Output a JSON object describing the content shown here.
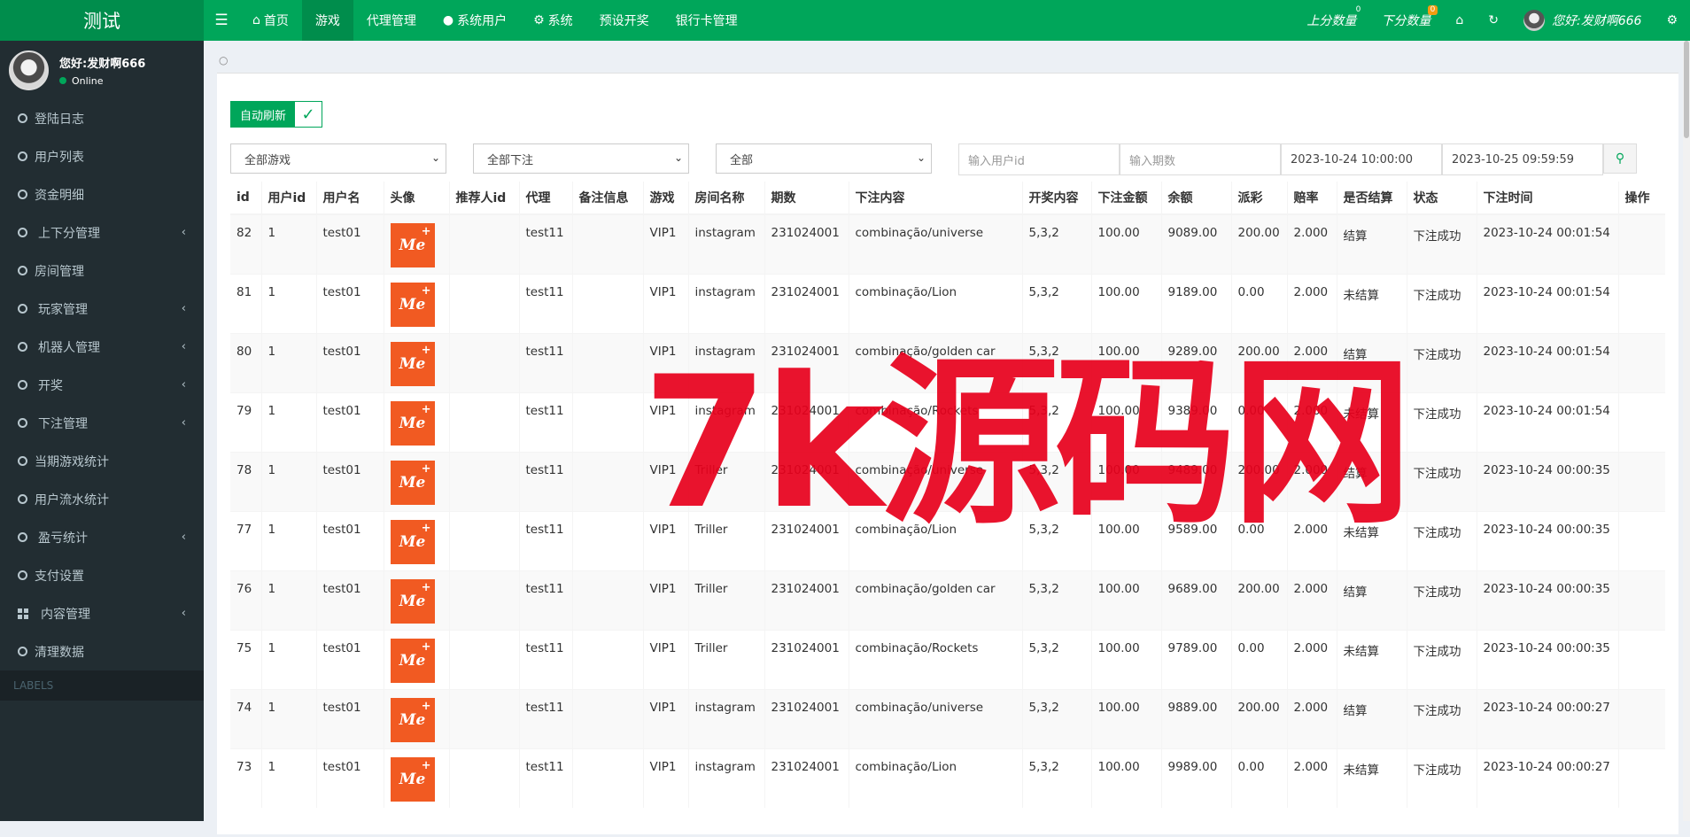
{
  "brand": "测试",
  "nav": {
    "items": [
      {
        "label": "首页",
        "icon": "home-icon"
      },
      {
        "label": "游戏",
        "active": true
      },
      {
        "label": "代理管理"
      },
      {
        "label": "系统用户",
        "icon": "user-icon"
      },
      {
        "label": "系统",
        "icon": "gear-icon"
      },
      {
        "label": "预设开奖"
      },
      {
        "label": "银行卡管理"
      }
    ],
    "up_score": "上分数量",
    "up_badge": "0",
    "down_score": "下分数量",
    "down_badge": "0",
    "greeting": "您好:发财啊666"
  },
  "sidebar": {
    "user_name": "您好:发财啊666",
    "status": "Online",
    "items": [
      {
        "label": "登陆日志"
      },
      {
        "label": "用户列表"
      },
      {
        "label": "资金明细"
      },
      {
        "label": "上下分管理",
        "has_children": true
      },
      {
        "label": "房间管理"
      },
      {
        "label": "玩家管理",
        "has_children": true
      },
      {
        "label": "机器人管理",
        "has_children": true
      },
      {
        "label": "开奖",
        "has_children": true
      },
      {
        "label": "下注管理",
        "has_children": true
      },
      {
        "label": "当期游戏统计"
      },
      {
        "label": "用户流水统计"
      },
      {
        "label": "盈亏统计",
        "has_children": true
      },
      {
        "label": "支付设置"
      },
      {
        "label": "内容管理",
        "has_children": true,
        "icon": "grid-icon"
      },
      {
        "label": "清理数据"
      }
    ],
    "labels_header": "LABELS"
  },
  "toolbar": {
    "auto_refresh": "自动刷新",
    "game_select": "全部游戏",
    "bet_select": "全部下注",
    "all_select": "全部",
    "user_id_placeholder": "输入用户id",
    "period_placeholder": "输入期数",
    "start_time": "2023-10-24 10:00:00",
    "end_time": "2023-10-25 09:59:59"
  },
  "table": {
    "headers": [
      "id",
      "用户id",
      "用户名",
      "头像",
      "推荐人id",
      "代理",
      "备注信息",
      "游戏",
      "房间名称",
      "期数",
      "下注内容",
      "开奖内容",
      "下注金额",
      "余额",
      "派彩",
      "赔率",
      "是否结算",
      "状态",
      "下注时间",
      "操作"
    ],
    "avatar_text": "Me",
    "rows": [
      {
        "id": "82",
        "uid": "1",
        "uname": "test01",
        "ref": "",
        "agent": "test11",
        "note": "",
        "game": "VIP1",
        "room": "instagram",
        "period": "231024001",
        "bet": "combinação/universe",
        "draw": "5,3,2",
        "amount": "100.00",
        "balance": "9089.00",
        "payout": "200.00",
        "odds": "2.000",
        "settled": "结算",
        "status": "下注成功",
        "time": "2023-10-24 00:01:54"
      },
      {
        "id": "81",
        "uid": "1",
        "uname": "test01",
        "ref": "",
        "agent": "test11",
        "note": "",
        "game": "VIP1",
        "room": "instagram",
        "period": "231024001",
        "bet": "combinação/Lion",
        "draw": "5,3,2",
        "amount": "100.00",
        "balance": "9189.00",
        "payout": "0.00",
        "odds": "2.000",
        "settled": "未结算",
        "status": "下注成功",
        "time": "2023-10-24 00:01:54"
      },
      {
        "id": "80",
        "uid": "1",
        "uname": "test01",
        "ref": "",
        "agent": "test11",
        "note": "",
        "game": "VIP1",
        "room": "instagram",
        "period": "231024001",
        "bet": "combinação/golden car",
        "draw": "5,3,2",
        "amount": "100.00",
        "balance": "9289.00",
        "payout": "200.00",
        "odds": "2.000",
        "settled": "结算",
        "status": "下注成功",
        "time": "2023-10-24 00:01:54"
      },
      {
        "id": "79",
        "uid": "1",
        "uname": "test01",
        "ref": "",
        "agent": "test11",
        "note": "",
        "game": "VIP1",
        "room": "instagram",
        "period": "231024001",
        "bet": "combinação/Rockets",
        "draw": "5,3,2",
        "amount": "100.00",
        "balance": "9389.00",
        "payout": "0.00",
        "odds": "2.000",
        "settled": "未结算",
        "status": "下注成功",
        "time": "2023-10-24 00:01:54"
      },
      {
        "id": "78",
        "uid": "1",
        "uname": "test01",
        "ref": "",
        "agent": "test11",
        "note": "",
        "game": "VIP1",
        "room": "Triller",
        "period": "231024001",
        "bet": "combinação/universe",
        "draw": "5,3,2",
        "amount": "100.00",
        "balance": "9489.00",
        "payout": "200.00",
        "odds": "2.000",
        "settled": "结算",
        "status": "下注成功",
        "time": "2023-10-24 00:00:35"
      },
      {
        "id": "77",
        "uid": "1",
        "uname": "test01",
        "ref": "",
        "agent": "test11",
        "note": "",
        "game": "VIP1",
        "room": "Triller",
        "period": "231024001",
        "bet": "combinação/Lion",
        "draw": "5,3,2",
        "amount": "100.00",
        "balance": "9589.00",
        "payout": "0.00",
        "odds": "2.000",
        "settled": "未结算",
        "status": "下注成功",
        "time": "2023-10-24 00:00:35"
      },
      {
        "id": "76",
        "uid": "1",
        "uname": "test01",
        "ref": "",
        "agent": "test11",
        "note": "",
        "game": "VIP1",
        "room": "Triller",
        "period": "231024001",
        "bet": "combinação/golden car",
        "draw": "5,3,2",
        "amount": "100.00",
        "balance": "9689.00",
        "payout": "200.00",
        "odds": "2.000",
        "settled": "结算",
        "status": "下注成功",
        "time": "2023-10-24 00:00:35"
      },
      {
        "id": "75",
        "uid": "1",
        "uname": "test01",
        "ref": "",
        "agent": "test11",
        "note": "",
        "game": "VIP1",
        "room": "Triller",
        "period": "231024001",
        "bet": "combinação/Rockets",
        "draw": "5,3,2",
        "amount": "100.00",
        "balance": "9789.00",
        "payout": "0.00",
        "odds": "2.000",
        "settled": "未结算",
        "status": "下注成功",
        "time": "2023-10-24 00:00:35"
      },
      {
        "id": "74",
        "uid": "1",
        "uname": "test01",
        "ref": "",
        "agent": "test11",
        "note": "",
        "game": "VIP1",
        "room": "instagram",
        "period": "231024001",
        "bet": "combinação/universe",
        "draw": "5,3,2",
        "amount": "100.00",
        "balance": "9889.00",
        "payout": "200.00",
        "odds": "2.000",
        "settled": "结算",
        "status": "下注成功",
        "time": "2023-10-24 00:00:27"
      },
      {
        "id": "73",
        "uid": "1",
        "uname": "test01",
        "ref": "",
        "agent": "test11",
        "note": "",
        "game": "VIP1",
        "room": "instagram",
        "period": "231024001",
        "bet": "combinação/Lion",
        "draw": "5,3,2",
        "amount": "100.00",
        "balance": "9989.00",
        "payout": "0.00",
        "odds": "2.000",
        "settled": "未结算",
        "status": "下注成功",
        "time": "2023-10-24 00:00:27"
      }
    ]
  },
  "watermark": "7k源码网",
  "colors": {
    "accent": "#00a65a",
    "accent_dark": "#008d4c",
    "sidebar_bg": "#222d32",
    "logo_orange": "#f15a22",
    "watermark_red": "#e8001c"
  }
}
